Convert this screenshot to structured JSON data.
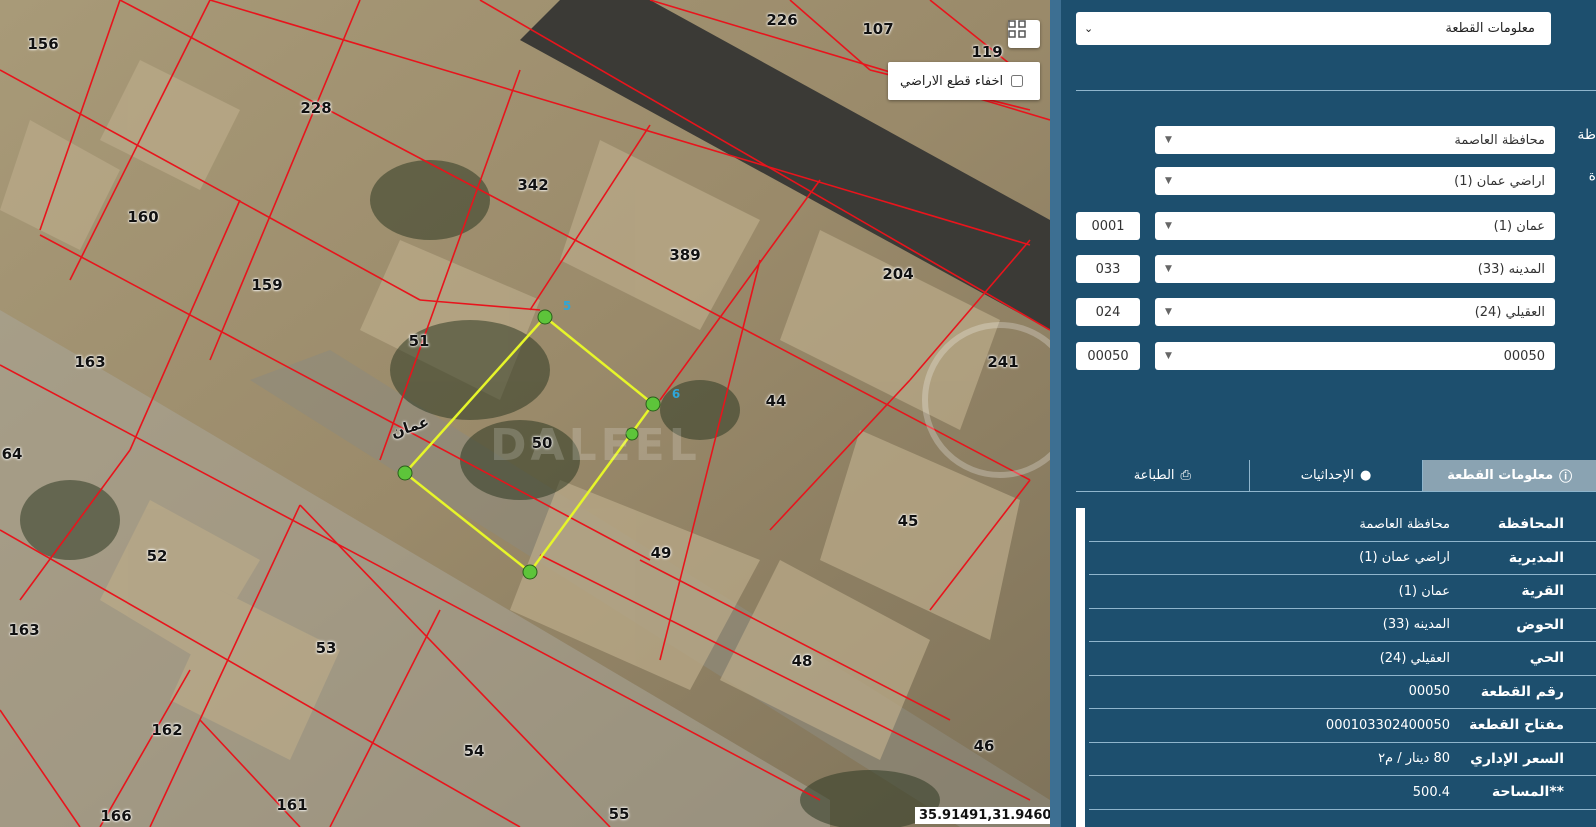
{
  "map": {
    "parcel_numbers": [
      "156",
      "226",
      "107",
      "119",
      "228",
      "342",
      "160",
      "389",
      "204",
      "159",
      "51",
      "163",
      "241",
      "44",
      "64",
      "50",
      "45",
      "52",
      "49",
      "163",
      "53",
      "48",
      "162",
      "54",
      "46",
      "161",
      "166",
      "55"
    ],
    "place_label": "عمان",
    "vertex_labels": [
      "5",
      "6"
    ],
    "watermark": "DALEEL",
    "hide_parcels_label": "اخفاء قطع الاراضي",
    "hide_parcels_checked": false,
    "coordinates": "35.91491,31.94604"
  },
  "panel": {
    "top_select": "معلومات القطعة",
    "side_labels": [
      "ظة",
      "ة"
    ],
    "dropdowns": [
      {
        "value": "محافظة العاصمة",
        "code": ""
      },
      {
        "value": "اراضي عمان (1)",
        "code": ""
      },
      {
        "value": "عمان (1)",
        "code": "0001"
      },
      {
        "value": "المدينه (33)",
        "code": "033"
      },
      {
        "value": "العقيلي (24)",
        "code": "024"
      },
      {
        "value": "00050",
        "code": "00050"
      }
    ],
    "tabs": [
      {
        "label": "معلومات القطعة",
        "icon": "info-icon",
        "active": true
      },
      {
        "label": "الإحداثيات",
        "icon": "map-pin-icon",
        "active": false
      },
      {
        "label": "الطباعة",
        "icon": "printer-icon",
        "active": false
      }
    ],
    "info_rows": [
      {
        "key": "المحافظة",
        "value": "محافظة العاصمة"
      },
      {
        "key": "المديرية",
        "value": "اراضي عمان (1)"
      },
      {
        "key": "القرية",
        "value": "عمان (1)"
      },
      {
        "key": "الحوض",
        "value": "المدينه (33)"
      },
      {
        "key": "الحي",
        "value": "العقيلي (24)"
      },
      {
        "key": "رقم القطعة",
        "value": "00050"
      },
      {
        "key": "مفتاح القطعة",
        "value": "000103302400050"
      },
      {
        "key": "السعر الإداري",
        "value": "80 دينار / م٢"
      },
      {
        "key": "**المساحة",
        "value": "500.4"
      }
    ]
  },
  "colors": {
    "panel_bg": "#1d4f6e",
    "parcel_line": "#e8141c",
    "selection": "#e6f52a",
    "vertex": "#5dc43a"
  }
}
